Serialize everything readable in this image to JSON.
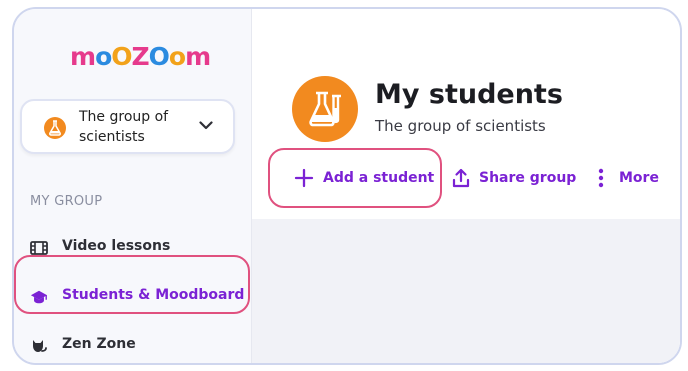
{
  "logo": {
    "text": "moozoom",
    "letters": [
      "m",
      "o",
      "O",
      "Z",
      "O",
      "o",
      "m"
    ],
    "colors": [
      "#e63a8c",
      "#2b8be0",
      "#f2a21a",
      "#e63a8c",
      "#2b8be0",
      "#f2a21a",
      "#e63a8c"
    ]
  },
  "group_selector": {
    "name": "The group of scientists",
    "avatar_icon": "flask-icon",
    "chevron_icon": "chevron-down-icon"
  },
  "sidebar": {
    "section_label": "MY GROUP",
    "items": [
      {
        "label": "Video lessons",
        "icon": "film-icon",
        "active": false
      },
      {
        "label": "Students & Moodboard",
        "icon": "graduation-cap-icon",
        "active": true
      },
      {
        "label": "Zen Zone",
        "icon": "cat-icon",
        "active": false
      }
    ]
  },
  "header": {
    "title": "My students",
    "subtitle": "The group of scientists",
    "avatar_icon": "flask-icon"
  },
  "actions": {
    "add_student": "Add a student",
    "share_group": "Share group",
    "more": "More"
  },
  "colors": {
    "accent": "#7b22d4",
    "highlight": "#e0517f",
    "avatar": "#f28a1f"
  }
}
